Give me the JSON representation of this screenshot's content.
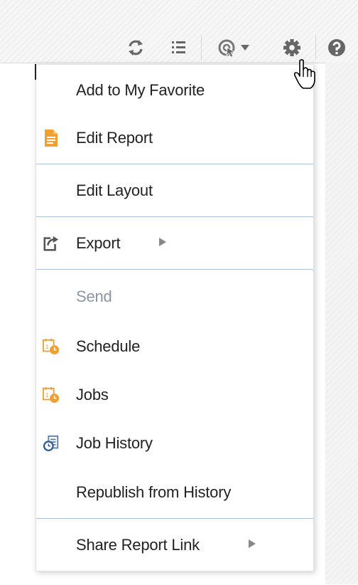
{
  "toolbar": {
    "icons": [
      "refresh-icon",
      "list-icon",
      "view-mode-icon",
      "settings-icon",
      "help-icon"
    ]
  },
  "menu": {
    "items": [
      {
        "label": "Add to My Favorite",
        "icon": null,
        "disabled": false,
        "submenu": false
      },
      {
        "label": "Edit Report",
        "icon": "document-icon",
        "disabled": false,
        "submenu": false
      },
      {
        "label": "Edit Layout",
        "icon": null,
        "disabled": false,
        "submenu": false
      },
      {
        "label": "Export",
        "icon": "export-icon",
        "disabled": false,
        "submenu": true
      },
      {
        "label": "Send",
        "icon": null,
        "disabled": true,
        "submenu": false
      },
      {
        "label": "Schedule",
        "icon": "schedule-icon",
        "disabled": false,
        "submenu": false
      },
      {
        "label": "Jobs",
        "icon": "jobs-icon",
        "disabled": false,
        "submenu": false
      },
      {
        "label": "Job History",
        "icon": "job-history-icon",
        "disabled": false,
        "submenu": false
      },
      {
        "label": "Republish from History",
        "icon": null,
        "disabled": false,
        "submenu": false
      },
      {
        "label": "Share Report Link",
        "icon": null,
        "disabled": false,
        "submenu": true
      }
    ]
  },
  "colors": {
    "accent_orange": "#f0a030",
    "divider_blue": "#aac1dd",
    "disabled_text": "#8a95a8",
    "icon_gray": "#555555"
  }
}
